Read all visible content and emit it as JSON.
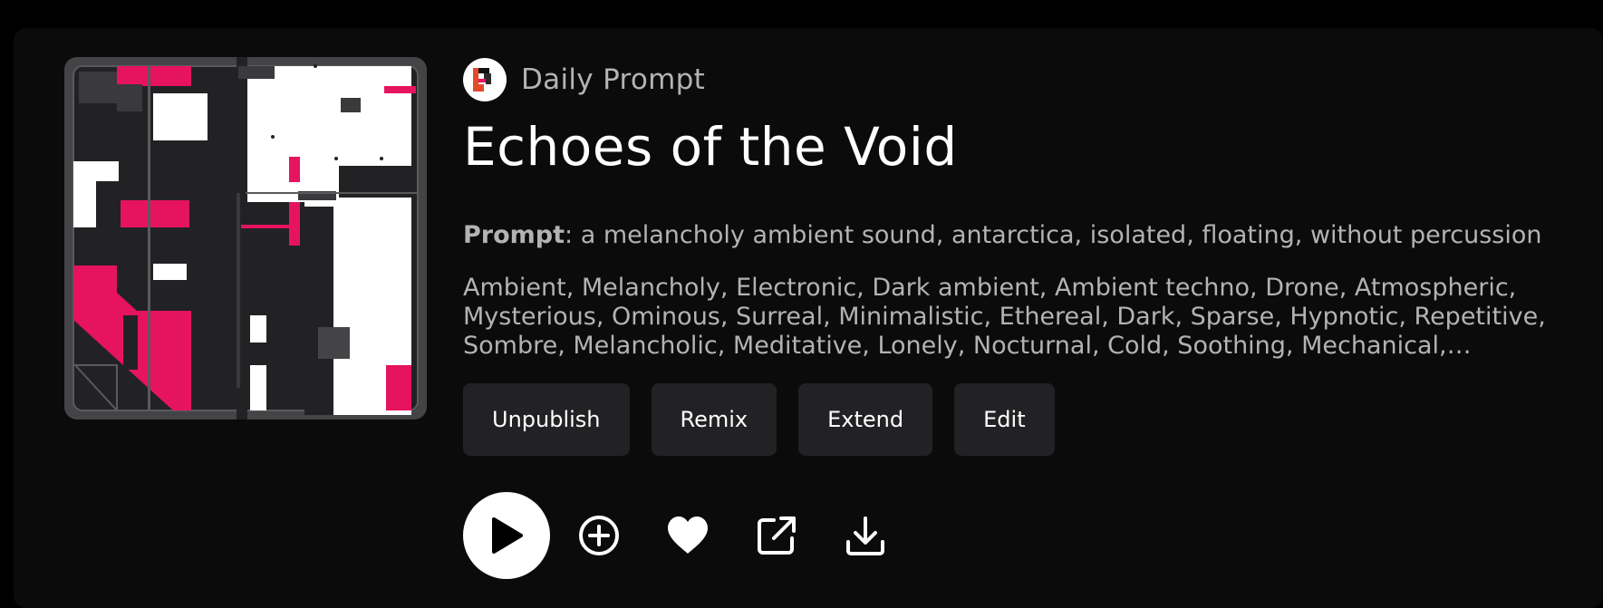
{
  "colors": {
    "background": "#000000",
    "card": "#0b0b0c",
    "button_bg": "#222225",
    "accent_pink": "#e6135f",
    "muted_text": "#b3b3b3"
  },
  "source": {
    "name": "Daily Prompt",
    "logo_icon": "daily-prompt-logo"
  },
  "title": "Echoes of the Void",
  "prompt": {
    "label": "Prompt",
    "text": ": a melancholy ambient sound, antarctica, isolated, floating, without percussion"
  },
  "tags": "Ambient, Melancholy, Electronic, Dark ambient, Ambient techno, Drone, Atmospheric, Mysterious, Ominous, Surreal, Minimalistic, Ethereal, Dark, Sparse, Hypnotic, Repetitive, Sombre, Melancholic, Meditative, Lonely, Nocturnal, Cold, Soothing, Mechanical, Space,...",
  "actions": {
    "unpublish": "Unpublish",
    "remix": "Remix",
    "extend": "Extend",
    "edit": "Edit"
  },
  "controls": [
    {
      "name": "play-icon"
    },
    {
      "name": "add-circle-icon"
    },
    {
      "name": "heart-icon"
    },
    {
      "name": "share-external-icon"
    },
    {
      "name": "download-icon"
    }
  ]
}
